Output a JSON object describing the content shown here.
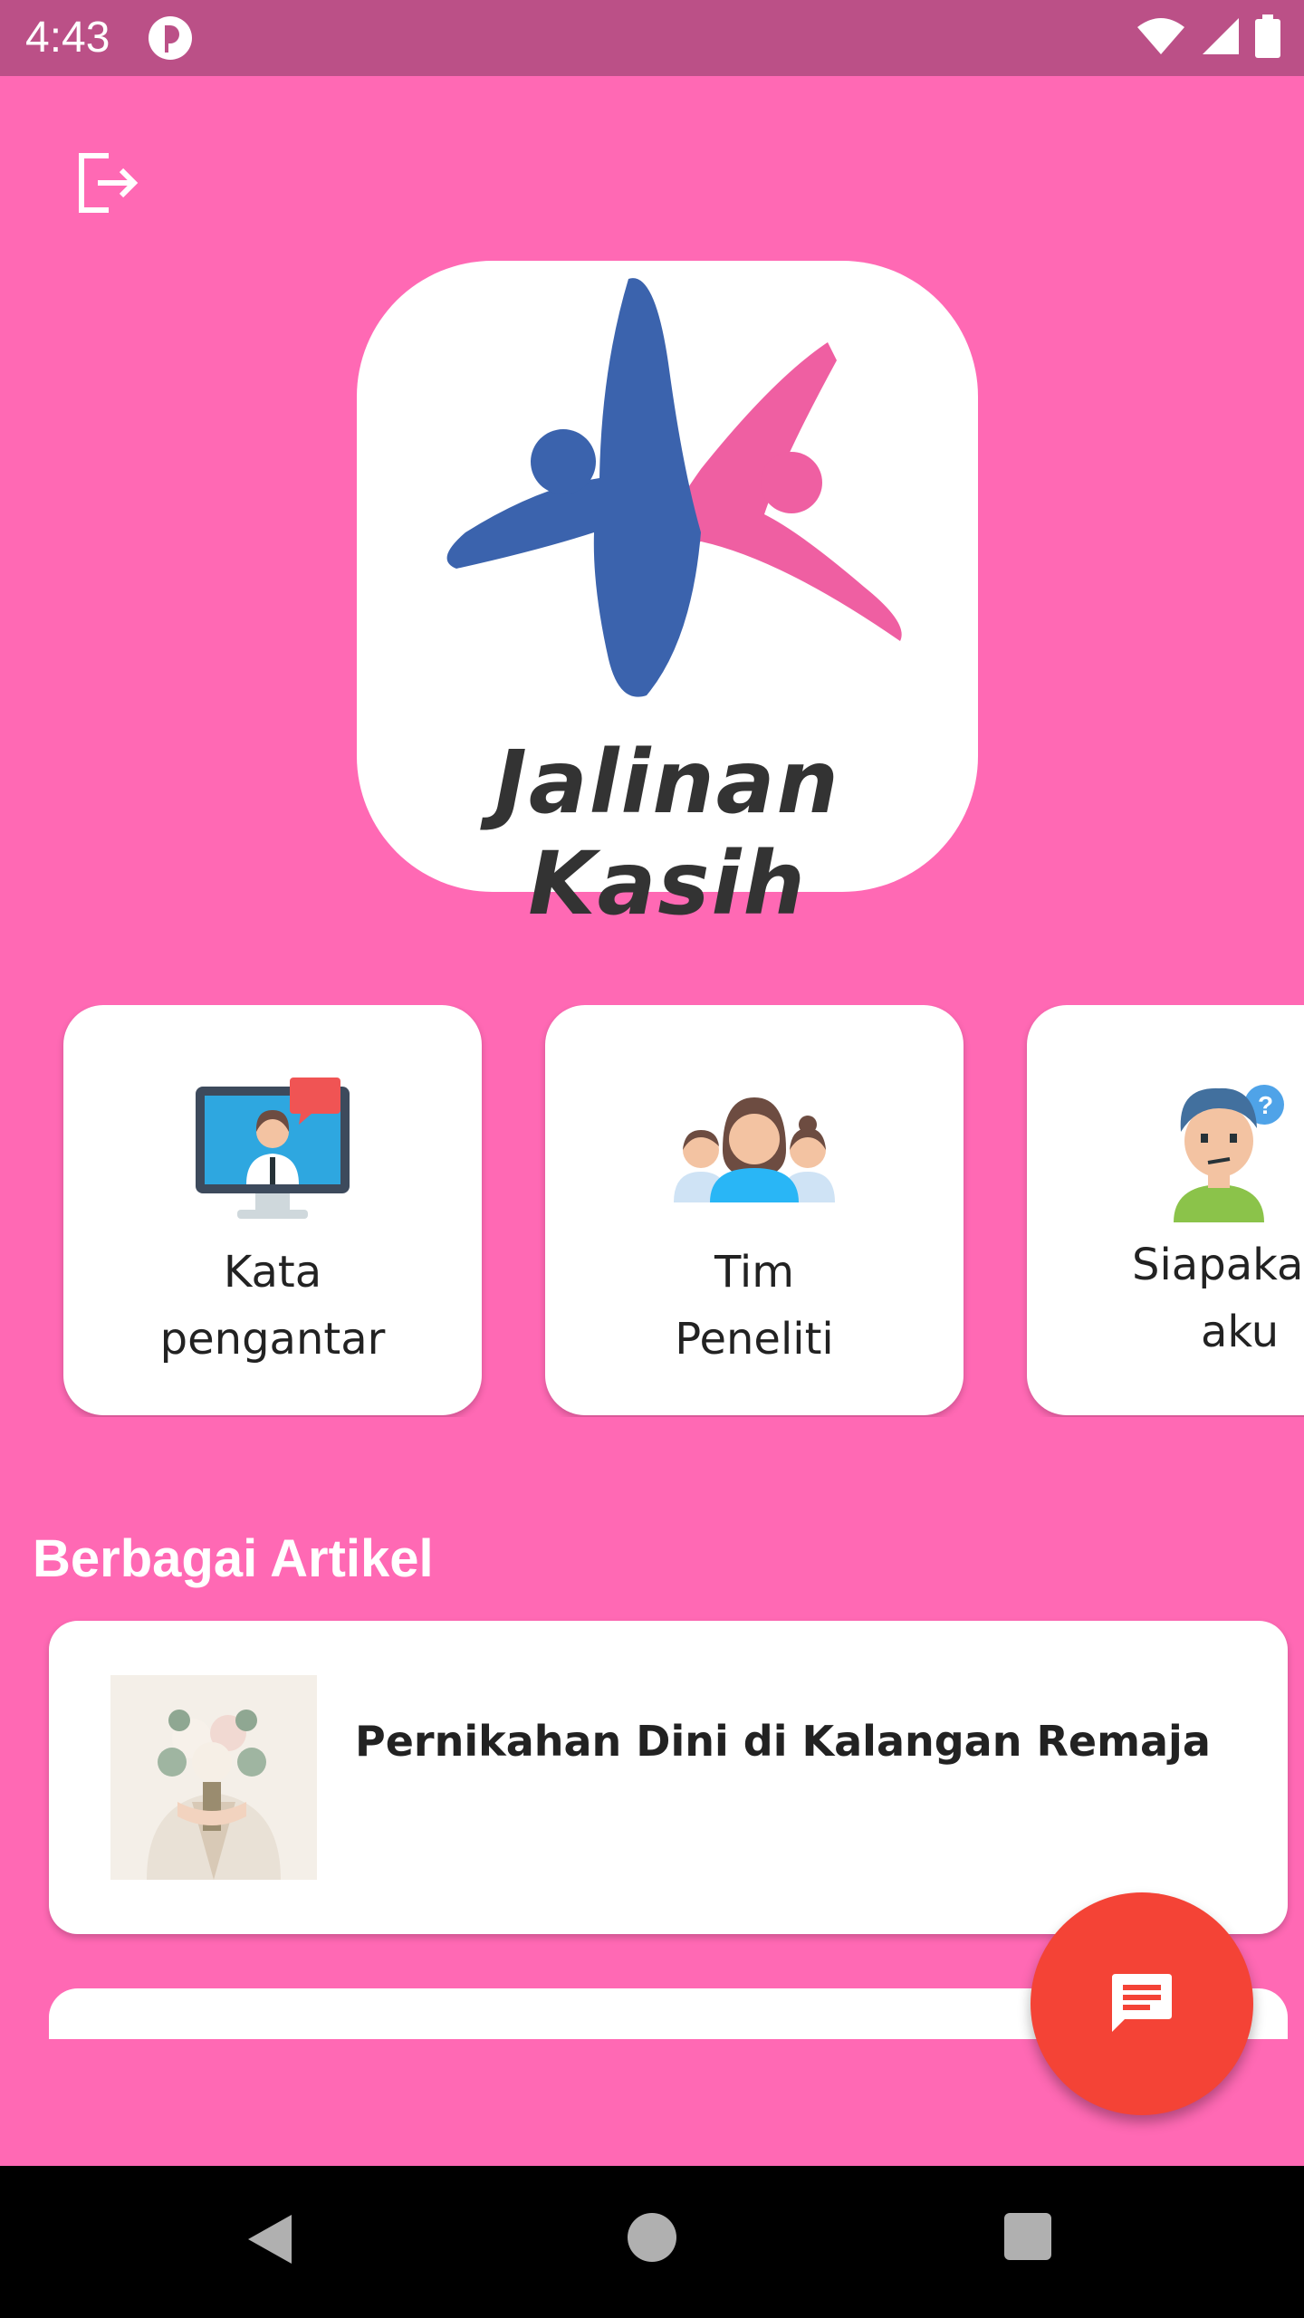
{
  "status_bar": {
    "time": "4:43",
    "icons": [
      "app-indicator-icon",
      "wifi-icon",
      "signal-icon",
      "battery-icon"
    ]
  },
  "header": {
    "logout_icon": "logout-icon"
  },
  "logo": {
    "text": "Jalinan Kasih",
    "colors": {
      "blue": "#3b63ad",
      "pink": "#ef5fa2"
    }
  },
  "menu": [
    {
      "label_line1": "Kata",
      "label_line2": "pengantar",
      "icon": "video-presentation-icon"
    },
    {
      "label_line1": "Tim",
      "label_line2": "Peneliti",
      "icon": "team-icon"
    },
    {
      "label_line1": "Siapaka",
      "label_line2": "aku",
      "icon": "confused-person-icon"
    }
  ],
  "articles": {
    "section_title": "Berbagai Artikel",
    "items": [
      {
        "title": "Pernikahan Dini di Kalangan Remaja",
        "thumbnail": "bridal-bouquet-image"
      }
    ]
  },
  "fab": {
    "icon": "chat-icon",
    "color": "#f44336"
  },
  "colors": {
    "background": "#ff69b4",
    "status_bar": "#bb5087"
  }
}
